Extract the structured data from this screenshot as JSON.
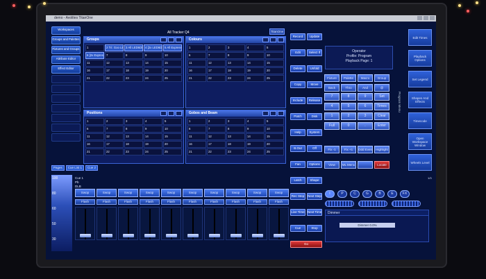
{
  "window": {
    "title": "demo - Avolites TitanOne"
  },
  "header": {
    "tracker": "All Tracker Q4",
    "titanone": "TitanOne"
  },
  "leftcol": [
    "Workspaces",
    "Groups and Palettes",
    "Fixtures and Groups",
    "Attribute Editor",
    "Effect Editor"
  ],
  "groups": {
    "title": "Groups",
    "cells": [
      "1",
      "2 Tri: Goo LiL",
      "3 All LED6DMX",
      "4 [2x LED6DMX]",
      "5 All Expressions",
      "6 [2x Expressio]",
      "7",
      "8",
      "9",
      "10",
      "11",
      "12",
      "13",
      "14",
      "15",
      "16",
      "17",
      "18",
      "19",
      "20",
      "21",
      "22",
      "23",
      "24",
      "25"
    ]
  },
  "colours": {
    "title": "Colours",
    "cells": [
      "1",
      "2",
      "3",
      "4",
      "5",
      "6",
      "7",
      "8",
      "9",
      "10",
      "11",
      "12",
      "13",
      "14",
      "15",
      "16",
      "17",
      "18",
      "19",
      "20",
      "21",
      "22",
      "23",
      "24",
      "25"
    ]
  },
  "positions": {
    "title": "Positions",
    "cells": [
      "1",
      "2",
      "3",
      "4",
      "5",
      "6",
      "7",
      "8",
      "9",
      "10",
      "11",
      "12",
      "13",
      "14",
      "15",
      "16",
      "17",
      "18",
      "19",
      "20",
      "21",
      "22",
      "23",
      "24",
      "25"
    ]
  },
  "gobos": {
    "title": "Gobos and Beam",
    "cells": [
      "1",
      "2",
      "3",
      "4",
      "5",
      "6",
      "7",
      "8",
      "9",
      "10",
      "11",
      "12",
      "13",
      "14",
      "15",
      "16",
      "17",
      "18",
      "19",
      "20",
      "21",
      "22",
      "23",
      "24",
      "25"
    ]
  },
  "pages": {
    "label": "Pages",
    "tabs": [
      "Cue List 1",
      "Cue 2"
    ]
  },
  "scale": [
    "100",
    "80",
    "60",
    "50",
    "30"
  ],
  "cue_info": [
    "Cue 1",
    "Pb",
    "DLB"
  ],
  "playbacks": {
    "swop": "Swop",
    "flash": "Flash",
    "count": 10,
    "levels": [
      0.05,
      0.05,
      0.05,
      0.05,
      0.05,
      0.05,
      0.05,
      0.05,
      0.05,
      0.05
    ]
  },
  "buttons": [
    [
      "Record",
      "Update"
    ],
    [
      "Edit",
      "Select If"
    ],
    [
      "Delete",
      "Unfold"
    ],
    [
      "Copy",
      "Move"
    ],
    [
      "Include",
      "Release"
    ],
    [
      "Patch",
      "Disk"
    ],
    [
      "Help",
      "System"
    ],
    [
      "B.Out",
      "Off"
    ],
    [
      "Fan",
      "Options"
    ],
    [
      "Latch",
      "Shape"
    ],
    [
      "Rec Step",
      "Next Step"
    ],
    [
      "Live Time",
      "Next Time"
    ],
    [
      "Cue",
      "Stop"
    ]
  ],
  "go": "Go",
  "operator": {
    "line1": "Operator",
    "line2": "Profile: Program",
    "line3": "Playback Page: 1"
  },
  "function_row": [
    "Fixture",
    "Palette",
    "Macro",
    "Group"
  ],
  "second_row": [
    "Back",
    "Thro",
    "And",
    "@"
  ],
  "keypad": [
    "7",
    "8",
    "9",
    "Set",
    "4",
    "5",
    "6",
    "Times",
    "1",
    "2",
    "3",
    "Clear",
    "Full",
    "0",
    ".",
    "Enter"
  ],
  "lower_row": [
    "Fix -1",
    "Fix +1",
    "Odd Even",
    "Highlight"
  ],
  "view_row": [
    "View",
    "ML Menu",
    "",
    "Locate"
  ],
  "right_tabs": [
    "Edit Times",
    "Playback Options",
    "Set Legend",
    "Shapes And Effects",
    "Timecode",
    "Open Workspace Window",
    "Wheels Level"
  ],
  "prog_menu": "Program Menu",
  "page_indicator": "1/3",
  "wheel_tabs": [
    "I",
    "P",
    "C",
    "G",
    "B",
    "E",
    "FX"
  ],
  "dimmer": {
    "title": "Dimmer",
    "value": "Dimmer 0.0%"
  }
}
